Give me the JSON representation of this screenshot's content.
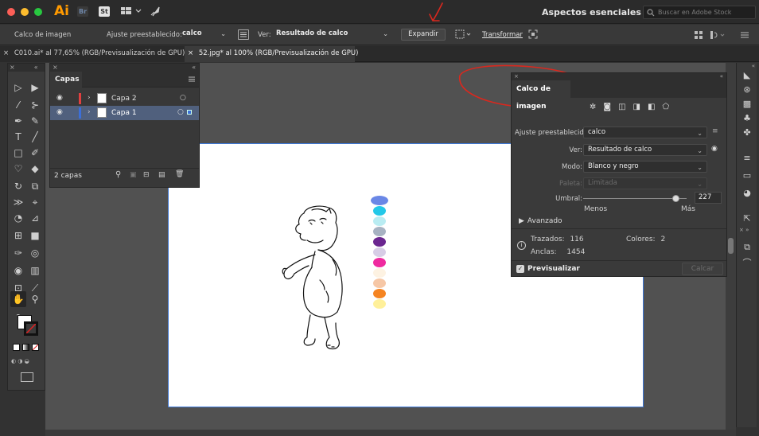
{
  "titlebar": {
    "app_logo": "Ai",
    "bridge_label": "Br",
    "stock_label": "St",
    "workspace": "Aspectos esenciales",
    "stock_search_placeholder": "Buscar en Adobe Stock"
  },
  "controlbar": {
    "tool_label": "Calco de imagen",
    "preset_label": "Ajuste preestablecido:",
    "preset_value": "calco",
    "view_label": "Ver:",
    "view_value": "Resultado de calco",
    "expand_button": "Expandir",
    "transform_link": "Transformar"
  },
  "tabs": [
    {
      "label": "C010.ai* al 77,65% (RGB/Previsualización de GPU)",
      "active": false
    },
    {
      "label": "52.jpg* al 100% (RGB/Previsualización de GPU)",
      "active": true
    }
  ],
  "layers_panel": {
    "title": "Capas",
    "layers": [
      {
        "name": "Capa 2",
        "color": "#e04040"
      },
      {
        "name": "Capa 1",
        "color": "#3c6fd8"
      }
    ],
    "count_label": "2 capas"
  },
  "trace_panel": {
    "title": "Calco de imagen",
    "preset_label": "Ajuste preestablecido:",
    "preset_value": "calco",
    "view_label": "Ver:",
    "view_value": "Resultado de calco",
    "mode_label": "Modo:",
    "mode_value": "Blanco y negro",
    "palette_label": "Paleta:",
    "palette_value": "Limitada",
    "threshold_label": "Umbral:",
    "threshold_value": "227",
    "threshold_fraction": 0.89,
    "less_label": "Menos",
    "more_label": "Más",
    "advanced_label": "Avanzado",
    "paths_label": "Trazados:",
    "paths_value": "116",
    "colors_label": "Colores:",
    "colors_value": "2",
    "anchors_label": "Anclas:",
    "anchors_value": "1454",
    "preview_label": "Previsualizar",
    "preview_checked": true,
    "trace_button": "Calcar"
  },
  "swatches": [
    "#6a87e6",
    "#23c8e8",
    "#b9ecf2",
    "#a7b2c2",
    "#6b2690",
    "#d7cde6",
    "#ef2a9f",
    "#fdf2e2",
    "#f6c7a6",
    "#f58421",
    "#fff09a"
  ],
  "colors": {
    "accent": "#3c6fd8",
    "annotation": "#d9281e",
    "ai_orange": "#ff9a00"
  }
}
